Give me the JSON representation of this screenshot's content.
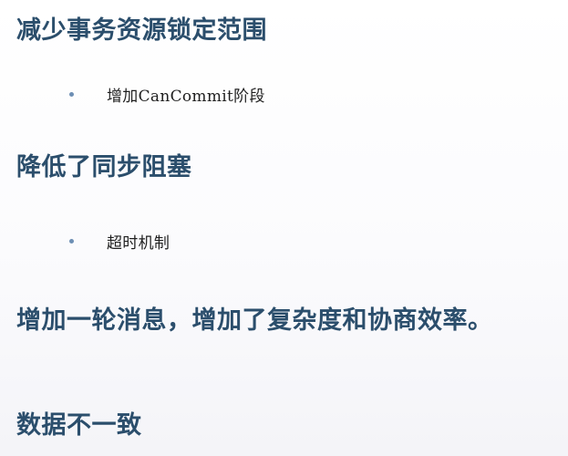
{
  "slide": {
    "headings": [
      "减少事务资源锁定范围",
      "降低了同步阻塞",
      "增加一轮消息，增加了复杂度和协商效率。",
      "数据不一致"
    ],
    "bullets": [
      "增加CanCommit阶段",
      "超时机制"
    ]
  },
  "colors": {
    "heading": "#2b4e6c",
    "bullet_dot": "#6d8fb4",
    "body_text": "#1f1f1f"
  }
}
